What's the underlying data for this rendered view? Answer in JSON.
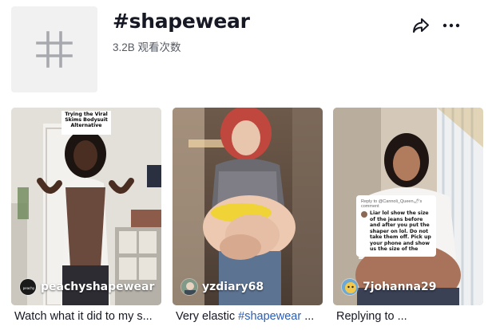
{
  "header": {
    "hashtag_icon": "hash-icon",
    "title": "#shapewear",
    "views": "3.2B 观看次数",
    "share_icon": "share-arrow-icon",
    "more_icon": "more-dots-icon"
  },
  "videos": [
    {
      "author": "peachyshapewear",
      "overlay_text": "Trying the Viral Skims Bodysuit Alternative",
      "description": "Watch what it did to my s..."
    },
    {
      "author": "yzdiary68",
      "description_prefix": "Very elastic ",
      "description_tag": "#shapewear",
      "description_suffix": " ..."
    },
    {
      "author": "7johanna29",
      "reply_to": "Reply to @Cannoli_Queen🌶's comment",
      "reply_text": "Liar lol show the size of the jeans before and after you put the shaper on lol. Do not take them off. Pick up your phone and show us the size of the",
      "description": "Replying to ..."
    }
  ],
  "colors": {
    "text": "#161823",
    "secondary_text": "#555a63",
    "hashtag_link": "#2b5db9",
    "tile_bg": "#f1f1f2"
  }
}
